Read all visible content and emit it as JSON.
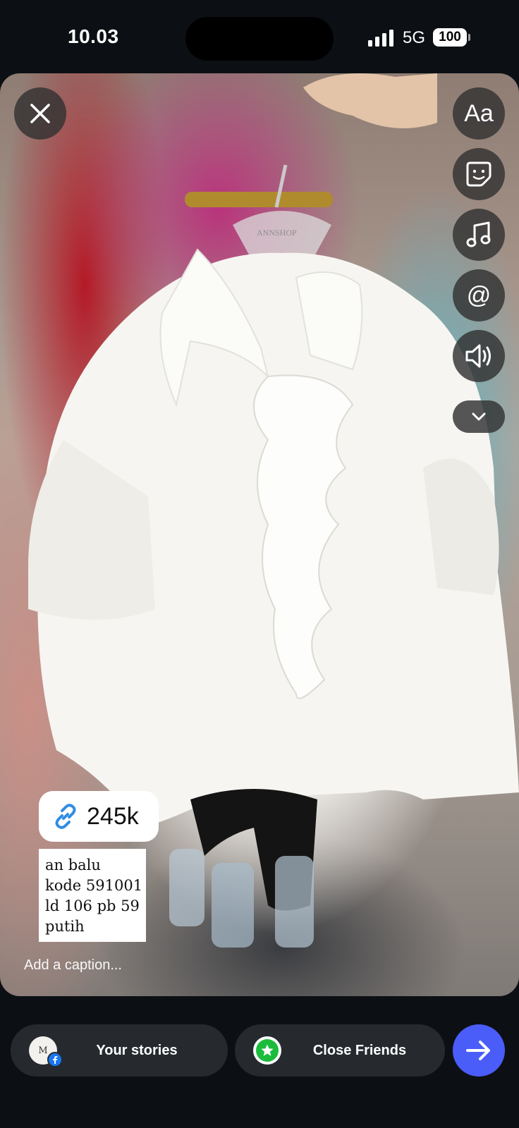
{
  "status_bar": {
    "time": "10.03",
    "network": "5G",
    "battery": "100"
  },
  "story": {
    "background_description_colors": {
      "blouse": "#f4f3ef",
      "rack": "#b41a27",
      "accent": "#b9337c"
    },
    "hanger_brand_text": "ANNSHOP",
    "tools": [
      {
        "name": "text-tool",
        "label": "Aa"
      },
      {
        "name": "sticker-tool",
        "icon": "sticker-icon"
      },
      {
        "name": "music-tool",
        "icon": "music-note-icon"
      },
      {
        "name": "mention-tool",
        "label": "@"
      },
      {
        "name": "sound-tool",
        "icon": "speaker-icon"
      },
      {
        "name": "more-tools",
        "icon": "chevron-down-icon"
      }
    ],
    "link_sticker": {
      "icon": "link-icon",
      "count": "245k"
    },
    "caption_lines": [
      "an balu",
      "kode 591001",
      "ld 106 pb 59",
      "putih"
    ],
    "add_caption_placeholder": "Add a caption..."
  },
  "bottom_bar": {
    "your_stories_label": "Your stories",
    "avatar_initial": "M",
    "close_friends_label": "Close Friends",
    "send_icon": "arrow-right-icon",
    "accent_color": "#4a5df9",
    "close_friends_color": "#1bbc3c"
  }
}
